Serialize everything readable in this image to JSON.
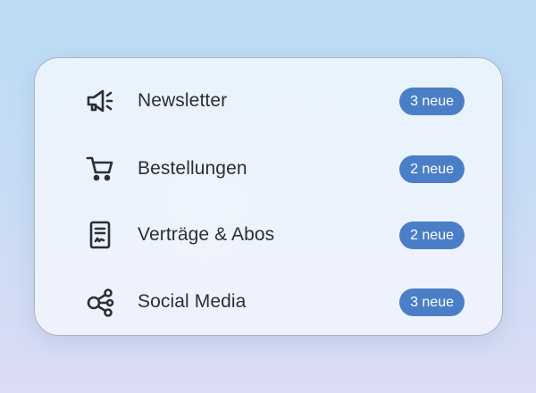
{
  "menu": {
    "items": [
      {
        "label": "Newsletter",
        "badge": "3 neue",
        "icon": "megaphone-icon"
      },
      {
        "label": "Bestellungen",
        "badge": "2 neue",
        "icon": "cart-icon"
      },
      {
        "label": "Verträge & Abos",
        "badge": "2 neue",
        "icon": "contract-icon"
      },
      {
        "label": "Social Media",
        "badge": "3 neue",
        "icon": "share-icon"
      }
    ]
  },
  "colors": {
    "badge": "#4a7fc7",
    "text": "#2b2f36",
    "icon": "#2b2f36"
  }
}
